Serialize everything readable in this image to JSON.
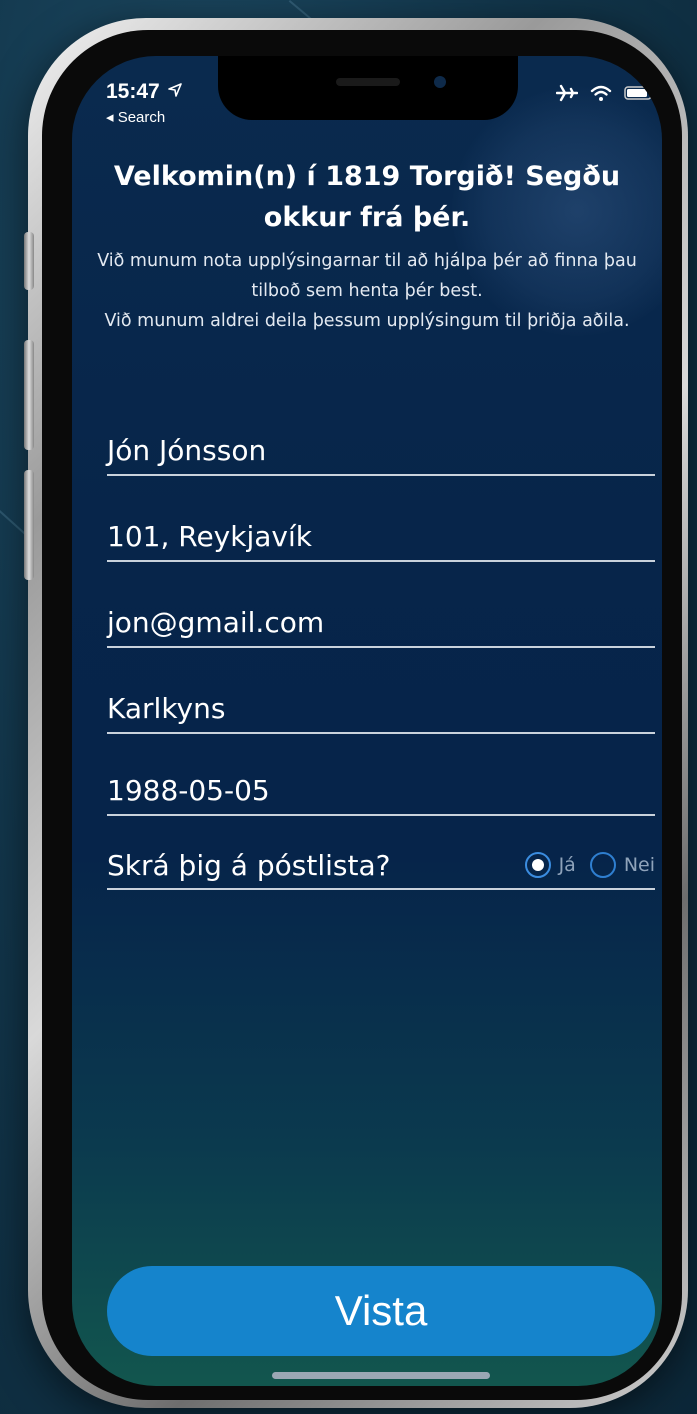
{
  "status_bar": {
    "time": "15:47",
    "back_label": "◂ Search"
  },
  "header": {
    "title": "Velkomin(n) í 1819 Torgið! Segðu okkur frá þér.",
    "description_line1": "Við munum nota upplýsingarnar til að hjálpa þér að finna þau tilboð sem henta þér best.",
    "description_line2": "Við munum aldrei deila þessum upplýsingum til þriðja aðila."
  },
  "form": {
    "name_value": "Jón Jónsson",
    "location_value": "101, Reykjavík",
    "email_value": "jon@gmail.com",
    "gender_value": "Karlkyns",
    "birthdate_value": "1988-05-05",
    "newsletter": {
      "label": "Skrá þig á póstlista?",
      "yes_label": "Já",
      "no_label": "Nei",
      "selected": "Já"
    }
  },
  "save_button": {
    "label": "Vista"
  },
  "colors": {
    "accent": "#1584cc",
    "background_top": "#0a2a4e",
    "background_bottom": "#12564e"
  },
  "icons": [
    "location-arrow-icon",
    "airplane-icon",
    "wifi-icon",
    "battery-icon",
    "radio-selected-icon",
    "radio-unselected-icon"
  ]
}
